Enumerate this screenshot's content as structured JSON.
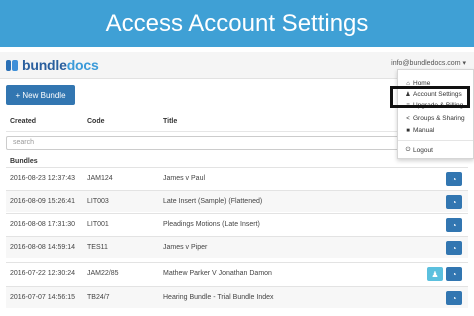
{
  "banner": {
    "title": "Access Account Settings"
  },
  "navbar": {
    "logo_main": "bundle",
    "logo_accent": "docs",
    "user_email": "info@bundledocs.com",
    "caret": "▾"
  },
  "toolbar": {
    "new_bundle_label": "+ New Bundle"
  },
  "table": {
    "headers": {
      "created": "Created",
      "code": "Code",
      "title": "Title"
    },
    "search_placeholder": "search",
    "section": "Bundles",
    "rows": [
      {
        "created": "2016-08-23 12:37:43",
        "code": "JAM124",
        "title": "James v Paul"
      },
      {
        "created": "2016-08-09 15:26:41",
        "code": "LIT003",
        "title": "Late Insert (Sample) (Flattened)"
      },
      {
        "created": "2016-08-08 17:31:30",
        "code": "LIT001",
        "title": "Pleadings Motions (Late Insert)"
      },
      {
        "created": "2016-08-08 14:59:14",
        "code": "TES11",
        "title": "James v Piper"
      },
      {
        "created": "2016-07-22 12:30:24",
        "code": "JAM22/85",
        "title": "Mathew Parker V Jonathan Damon"
      },
      {
        "created": "2016-07-07 14:56:15",
        "code": "TB24/7",
        "title": "Hearing Bundle - Trial Bundle Index"
      }
    ]
  },
  "dropdown": {
    "items": [
      {
        "label": "Home",
        "icon": "home-icon"
      },
      {
        "label": "Account Settings",
        "icon": "user-icon"
      },
      {
        "label": "Upgrade & Billing",
        "icon": "billing-icon"
      },
      {
        "label": "Groups & Sharing",
        "icon": "share-icon"
      },
      {
        "label": "Manual",
        "icon": "book-icon"
      },
      {
        "label": "Logout",
        "icon": "power-icon"
      }
    ]
  },
  "colors": {
    "banner": "#3fa0d5",
    "primary": "#3276b1",
    "info": "#5bc0de",
    "highlight": "#111111"
  }
}
